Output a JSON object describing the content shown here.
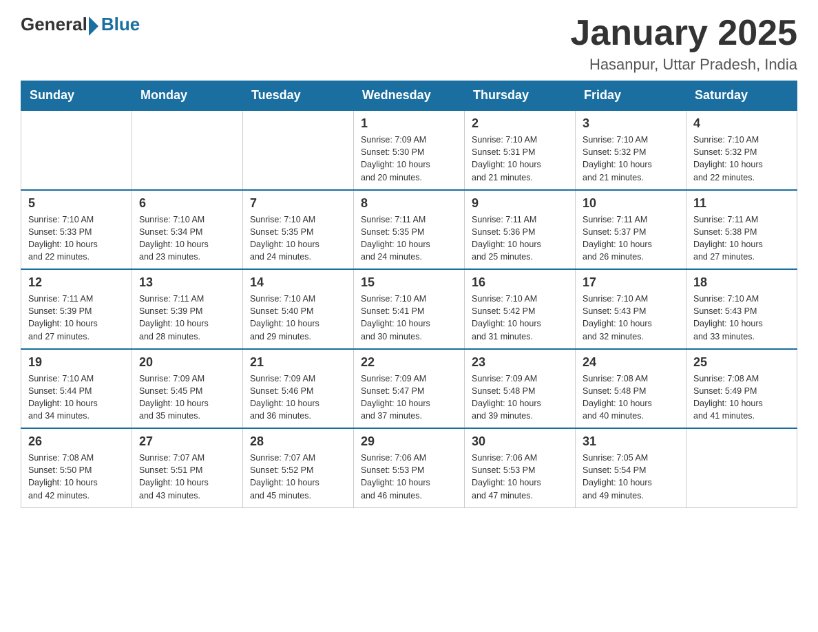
{
  "header": {
    "logo_general": "General",
    "logo_blue": "Blue",
    "title": "January 2025",
    "subtitle": "Hasanpur, Uttar Pradesh, India"
  },
  "weekdays": [
    "Sunday",
    "Monday",
    "Tuesday",
    "Wednesday",
    "Thursday",
    "Friday",
    "Saturday"
  ],
  "weeks": [
    [
      {
        "day": "",
        "info": ""
      },
      {
        "day": "",
        "info": ""
      },
      {
        "day": "",
        "info": ""
      },
      {
        "day": "1",
        "info": "Sunrise: 7:09 AM\nSunset: 5:30 PM\nDaylight: 10 hours\nand 20 minutes."
      },
      {
        "day": "2",
        "info": "Sunrise: 7:10 AM\nSunset: 5:31 PM\nDaylight: 10 hours\nand 21 minutes."
      },
      {
        "day": "3",
        "info": "Sunrise: 7:10 AM\nSunset: 5:32 PM\nDaylight: 10 hours\nand 21 minutes."
      },
      {
        "day": "4",
        "info": "Sunrise: 7:10 AM\nSunset: 5:32 PM\nDaylight: 10 hours\nand 22 minutes."
      }
    ],
    [
      {
        "day": "5",
        "info": "Sunrise: 7:10 AM\nSunset: 5:33 PM\nDaylight: 10 hours\nand 22 minutes."
      },
      {
        "day": "6",
        "info": "Sunrise: 7:10 AM\nSunset: 5:34 PM\nDaylight: 10 hours\nand 23 minutes."
      },
      {
        "day": "7",
        "info": "Sunrise: 7:10 AM\nSunset: 5:35 PM\nDaylight: 10 hours\nand 24 minutes."
      },
      {
        "day": "8",
        "info": "Sunrise: 7:11 AM\nSunset: 5:35 PM\nDaylight: 10 hours\nand 24 minutes."
      },
      {
        "day": "9",
        "info": "Sunrise: 7:11 AM\nSunset: 5:36 PM\nDaylight: 10 hours\nand 25 minutes."
      },
      {
        "day": "10",
        "info": "Sunrise: 7:11 AM\nSunset: 5:37 PM\nDaylight: 10 hours\nand 26 minutes."
      },
      {
        "day": "11",
        "info": "Sunrise: 7:11 AM\nSunset: 5:38 PM\nDaylight: 10 hours\nand 27 minutes."
      }
    ],
    [
      {
        "day": "12",
        "info": "Sunrise: 7:11 AM\nSunset: 5:39 PM\nDaylight: 10 hours\nand 27 minutes."
      },
      {
        "day": "13",
        "info": "Sunrise: 7:11 AM\nSunset: 5:39 PM\nDaylight: 10 hours\nand 28 minutes."
      },
      {
        "day": "14",
        "info": "Sunrise: 7:10 AM\nSunset: 5:40 PM\nDaylight: 10 hours\nand 29 minutes."
      },
      {
        "day": "15",
        "info": "Sunrise: 7:10 AM\nSunset: 5:41 PM\nDaylight: 10 hours\nand 30 minutes."
      },
      {
        "day": "16",
        "info": "Sunrise: 7:10 AM\nSunset: 5:42 PM\nDaylight: 10 hours\nand 31 minutes."
      },
      {
        "day": "17",
        "info": "Sunrise: 7:10 AM\nSunset: 5:43 PM\nDaylight: 10 hours\nand 32 minutes."
      },
      {
        "day": "18",
        "info": "Sunrise: 7:10 AM\nSunset: 5:43 PM\nDaylight: 10 hours\nand 33 minutes."
      }
    ],
    [
      {
        "day": "19",
        "info": "Sunrise: 7:10 AM\nSunset: 5:44 PM\nDaylight: 10 hours\nand 34 minutes."
      },
      {
        "day": "20",
        "info": "Sunrise: 7:09 AM\nSunset: 5:45 PM\nDaylight: 10 hours\nand 35 minutes."
      },
      {
        "day": "21",
        "info": "Sunrise: 7:09 AM\nSunset: 5:46 PM\nDaylight: 10 hours\nand 36 minutes."
      },
      {
        "day": "22",
        "info": "Sunrise: 7:09 AM\nSunset: 5:47 PM\nDaylight: 10 hours\nand 37 minutes."
      },
      {
        "day": "23",
        "info": "Sunrise: 7:09 AM\nSunset: 5:48 PM\nDaylight: 10 hours\nand 39 minutes."
      },
      {
        "day": "24",
        "info": "Sunrise: 7:08 AM\nSunset: 5:48 PM\nDaylight: 10 hours\nand 40 minutes."
      },
      {
        "day": "25",
        "info": "Sunrise: 7:08 AM\nSunset: 5:49 PM\nDaylight: 10 hours\nand 41 minutes."
      }
    ],
    [
      {
        "day": "26",
        "info": "Sunrise: 7:08 AM\nSunset: 5:50 PM\nDaylight: 10 hours\nand 42 minutes."
      },
      {
        "day": "27",
        "info": "Sunrise: 7:07 AM\nSunset: 5:51 PM\nDaylight: 10 hours\nand 43 minutes."
      },
      {
        "day": "28",
        "info": "Sunrise: 7:07 AM\nSunset: 5:52 PM\nDaylight: 10 hours\nand 45 minutes."
      },
      {
        "day": "29",
        "info": "Sunrise: 7:06 AM\nSunset: 5:53 PM\nDaylight: 10 hours\nand 46 minutes."
      },
      {
        "day": "30",
        "info": "Sunrise: 7:06 AM\nSunset: 5:53 PM\nDaylight: 10 hours\nand 47 minutes."
      },
      {
        "day": "31",
        "info": "Sunrise: 7:05 AM\nSunset: 5:54 PM\nDaylight: 10 hours\nand 49 minutes."
      },
      {
        "day": "",
        "info": ""
      }
    ]
  ]
}
